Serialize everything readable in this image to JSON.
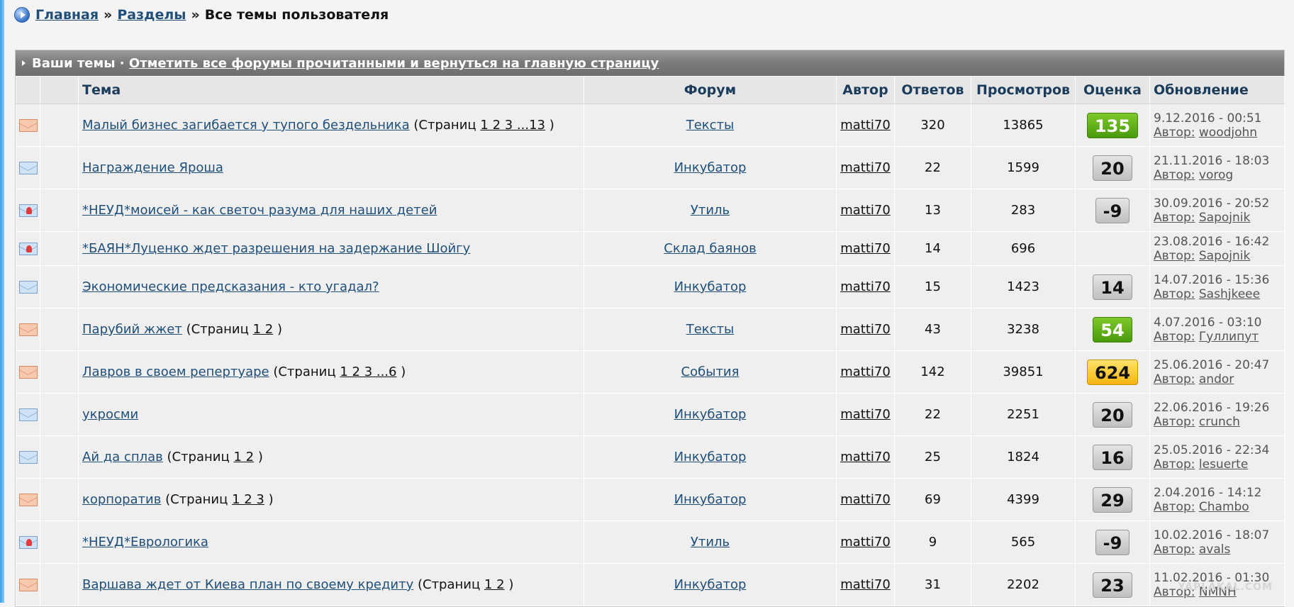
{
  "breadcrumb": {
    "home": "Главная",
    "sections": "Разделы",
    "separator": "»",
    "current": "Все темы пользователя"
  },
  "panel": {
    "title": "Ваши темы ·",
    "mark_all_link": "Отметить все форумы прочитанными и вернуться на главную страницу"
  },
  "columns": {
    "topic": "Тема",
    "forum": "Форум",
    "author": "Автор",
    "replies": "Ответов",
    "views": "Просмотров",
    "rating": "Оценка",
    "updated": "Обновление"
  },
  "pages_prefix": "(Страниц",
  "updated_author_prefix": "Автор:",
  "rows": [
    {
      "icon": "envelope-orange",
      "topic": "Малый бизнес загибается у тупого бездельника",
      "pages": "1 2 3 ...13",
      "forum": "Тексты",
      "author": "matti70",
      "replies": "320",
      "views": "13865",
      "rating": "135",
      "rating_color": "green",
      "updated": "9.12.2016 - 00:51",
      "updated_by": "woodjohn"
    },
    {
      "icon": "envelope-blue",
      "topic": "Награждение Яроша",
      "pages": "",
      "forum": "Инкубатор",
      "author": "matti70",
      "replies": "22",
      "views": "1599",
      "rating": "20",
      "rating_color": "grey",
      "updated": "21.11.2016 - 18:03",
      "updated_by": "vorog"
    },
    {
      "icon": "envelope-locked",
      "topic": "*НЕУД*моисей - как светоч разума для наших детей",
      "pages": "",
      "forum": "Утиль",
      "author": "matti70",
      "replies": "13",
      "views": "283",
      "rating": "-9",
      "rating_color": "grey",
      "updated": "30.09.2016 - 20:52",
      "updated_by": "Sapojnik"
    },
    {
      "icon": "envelope-locked",
      "topic": "*БАЯН*Луценко ждет разрешения на задержание Шойгу",
      "pages": "",
      "forum": "Склад баянов",
      "author": "matti70",
      "replies": "14",
      "views": "696",
      "rating": "",
      "rating_color": "none",
      "updated": "23.08.2016 - 16:42",
      "updated_by": "Sapojnik"
    },
    {
      "icon": "envelope-blue",
      "topic": "Экономические предсказания - кто угадал?",
      "pages": "",
      "forum": "Инкубатор",
      "author": "matti70",
      "replies": "15",
      "views": "1423",
      "rating": "14",
      "rating_color": "grey",
      "updated": "14.07.2016 - 15:36",
      "updated_by": "Sashjkeee"
    },
    {
      "icon": "envelope-orange",
      "topic": "Парубий жжет",
      "pages": "1 2",
      "forum": "Тексты",
      "author": "matti70",
      "replies": "43",
      "views": "3238",
      "rating": "54",
      "rating_color": "green",
      "updated": "4.07.2016 - 03:10",
      "updated_by": "Гуллипут"
    },
    {
      "icon": "envelope-orange",
      "topic": "Лавров в своем репертуаре",
      "pages": "1 2 3 ...6",
      "forum": "События",
      "author": "matti70",
      "replies": "142",
      "views": "39851",
      "rating": "624",
      "rating_color": "yellow",
      "updated": "25.06.2016 - 20:47",
      "updated_by": "andor"
    },
    {
      "icon": "envelope-blue",
      "topic": "укросми",
      "pages": "",
      "forum": "Инкубатор",
      "author": "matti70",
      "replies": "22",
      "views": "2251",
      "rating": "20",
      "rating_color": "grey",
      "updated": "22.06.2016 - 19:26",
      "updated_by": "crunch"
    },
    {
      "icon": "envelope-blue",
      "topic": "Ай да сплав",
      "pages": "1 2",
      "forum": "Инкубатор",
      "author": "matti70",
      "replies": "25",
      "views": "1824",
      "rating": "16",
      "rating_color": "grey",
      "updated": "25.05.2016 - 22:34",
      "updated_by": "lesuerte"
    },
    {
      "icon": "envelope-orange",
      "topic": "корпоратив",
      "pages": "1 2 3",
      "forum": "Инкубатор",
      "author": "matti70",
      "replies": "69",
      "views": "4399",
      "rating": "29",
      "rating_color": "grey",
      "updated": "2.04.2016 - 14:12",
      "updated_by": "Chambo"
    },
    {
      "icon": "envelope-locked",
      "topic": "*НЕУД*Еврологика",
      "pages": "",
      "forum": "Утиль",
      "author": "matti70",
      "replies": "9",
      "views": "565",
      "rating": "-9",
      "rating_color": "grey",
      "updated": "10.02.2016 - 18:07",
      "updated_by": "avals"
    },
    {
      "icon": "envelope-orange",
      "topic": "Варшава ждет от Киева план по своему кредиту",
      "pages": "1 2",
      "forum": "Инкубатор",
      "author": "matti70",
      "replies": "31",
      "views": "2202",
      "rating": "23",
      "rating_color": "grey",
      "updated": "11.02.2016 - 01:30",
      "updated_by": "NMNH"
    }
  ],
  "watermark": "YAPLAKAL.COM"
}
